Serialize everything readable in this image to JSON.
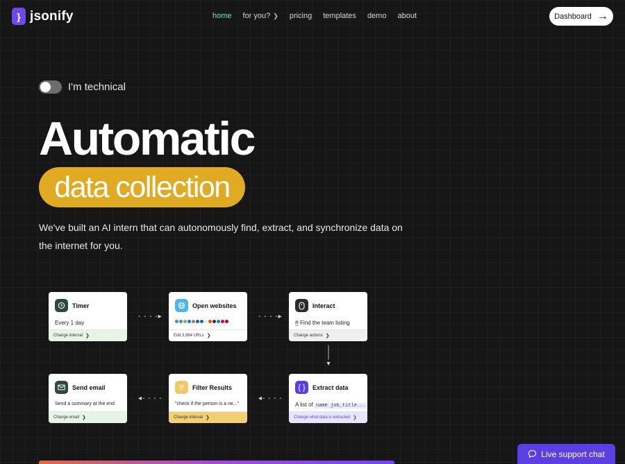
{
  "nav": {
    "logo_mark": "}",
    "brand": "jsonify",
    "links": [
      {
        "label": "home",
        "active": true
      },
      {
        "label": "for you?",
        "has_chevron": true
      },
      {
        "label": "pricing"
      },
      {
        "label": "templates"
      },
      {
        "label": "demo"
      },
      {
        "label": "about"
      }
    ],
    "dashboard_label": "Dashboard"
  },
  "hero": {
    "toggle_label": "I'm technical",
    "toggle_on": false,
    "headline": "Automatic",
    "highlight": "data collection",
    "subtext": "We've built an AI intern that can autonomously find, extract, and synchronize data on the internet for you."
  },
  "flow": {
    "timer": {
      "title": "Timer",
      "body": "Every 1 day",
      "foot": "Change interval",
      "icon": "clock-icon"
    },
    "open": {
      "title": "Open websites",
      "foot": "Edit 3,964 URLs",
      "icon": "globe-icon"
    },
    "interact": {
      "title": "Interact",
      "body": "Find the team listing",
      "foot": "Change actions",
      "icon": "mouse-icon"
    },
    "extract": {
      "title": "Extract data",
      "body_prefix": "A list of",
      "body_code": "name job_title...",
      "foot": "Change what data is extracted",
      "icon": "braces-icon"
    },
    "filter": {
      "title": "Filter Results",
      "body": "\"check if the person is a ne...\"",
      "foot": "Change interval",
      "icon": "filter-icon"
    },
    "email": {
      "title": "Send email",
      "body": "Send a summary at the end",
      "foot": "Change email",
      "icon": "mail-icon"
    }
  },
  "chat": {
    "label": "Live support chat",
    "icon": "chat-bubble-icon"
  },
  "colors": {
    "accent": "#6d48ec",
    "highlight": "#e0aa22",
    "active_link": "#6ee7a5"
  }
}
